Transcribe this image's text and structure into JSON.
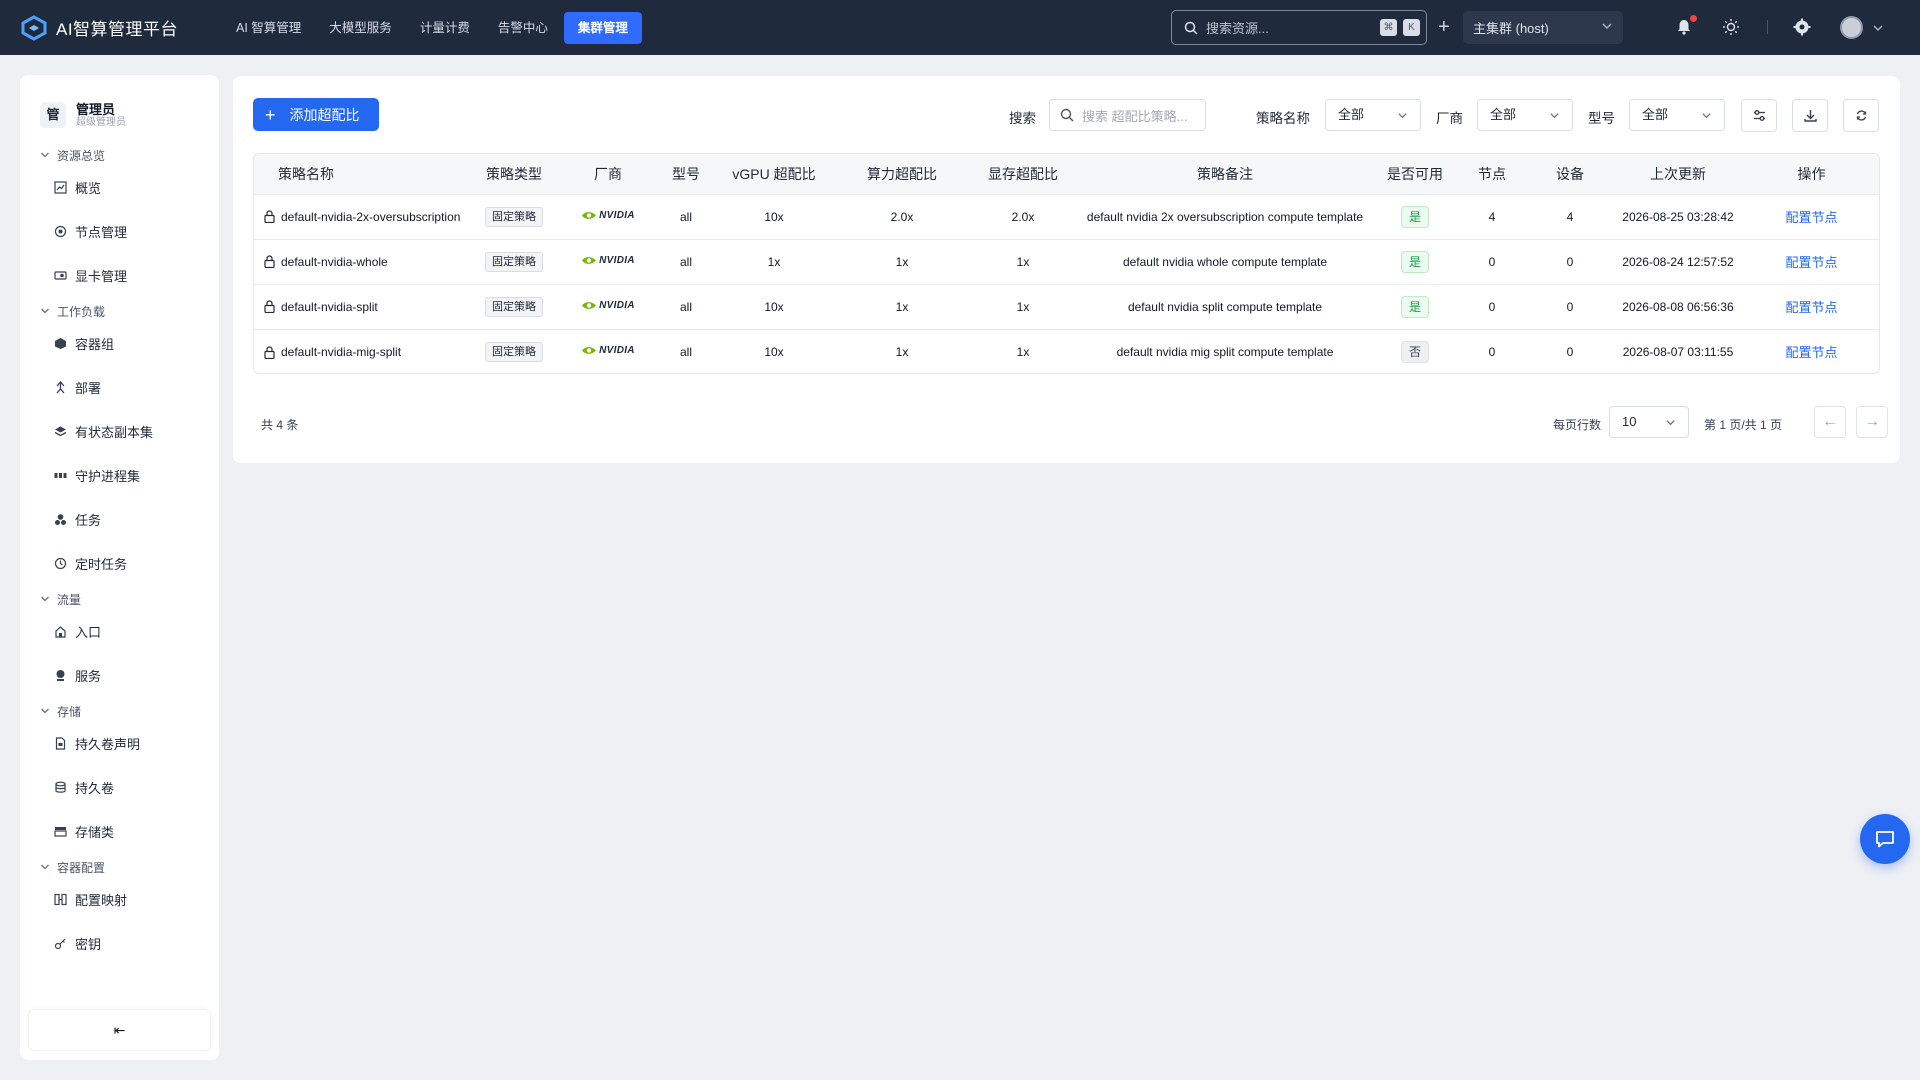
{
  "app": {
    "title": "AI智算管理平台"
  },
  "nav": [
    {
      "label": "AI 智算管理",
      "active": false
    },
    {
      "label": "大模型服务",
      "active": false
    },
    {
      "label": "计量计费",
      "active": false
    },
    {
      "label": "告警中心",
      "active": false
    },
    {
      "label": "集群管理",
      "active": true
    }
  ],
  "topbar": {
    "search_placeholder": "搜索资源...",
    "kbd": [
      "⌘",
      "K"
    ],
    "cluster": "主集群 (host)"
  },
  "sidebar": {
    "user": {
      "avatar_char": "管",
      "name": "管理员",
      "role": "超级管理员"
    },
    "groups": [
      {
        "label": "资源总览",
        "items": [
          {
            "label": "概览",
            "icon": "chart-icon"
          },
          {
            "label": "节点管理",
            "icon": "node-icon"
          },
          {
            "label": "显卡管理",
            "icon": "gpu-icon"
          }
        ]
      },
      {
        "label": "工作负载",
        "items": [
          {
            "label": "容器组",
            "icon": "cube-icon"
          },
          {
            "label": "部署",
            "icon": "deploy-icon"
          },
          {
            "label": "有状态副本集",
            "icon": "layers-icon"
          },
          {
            "label": "守护进程集",
            "icon": "daemon-icon"
          },
          {
            "label": "任务",
            "icon": "task-icon"
          },
          {
            "label": "定时任务",
            "icon": "clock-icon"
          }
        ]
      },
      {
        "label": "流量",
        "items": [
          {
            "label": "入口",
            "icon": "ingress-icon"
          },
          {
            "label": "服务",
            "icon": "service-icon"
          }
        ]
      },
      {
        "label": "存储",
        "items": [
          {
            "label": "持久卷声明",
            "icon": "pvc-icon"
          },
          {
            "label": "持久卷",
            "icon": "database-icon"
          },
          {
            "label": "存储类",
            "icon": "storage-class-icon"
          }
        ]
      },
      {
        "label": "容器配置",
        "items": [
          {
            "label": "配置映射",
            "icon": "configmap-icon"
          },
          {
            "label": "密钥",
            "icon": "key-icon"
          }
        ]
      }
    ],
    "collapse_glyph": "⇤"
  },
  "toolbar": {
    "add_label": "添加超配比",
    "search_label": "搜索",
    "search_placeholder": "搜索 超配比策略...",
    "filter_name_label": "策略名称",
    "filter_name_value": "全部",
    "filter_vendor_label": "厂商",
    "filter_vendor_value": "全部",
    "filter_model_label": "型号",
    "filter_model_value": "全部"
  },
  "table": {
    "headers": [
      "策略名称",
      "策略类型",
      "厂商",
      "型号",
      "vGPU 超配比",
      "算力超配比",
      "显存超配比",
      "策略备注",
      "是否可用",
      "节点",
      "设备",
      "上次更新",
      "操作"
    ],
    "rows": [
      {
        "name": "default-nvidia-2x-oversubscription",
        "type": "固定策略",
        "vendor": "NVIDIA",
        "model": "all",
        "vgpu": "10x",
        "compute": "2.0x",
        "memory": "2.0x",
        "note": "default nvidia 2x oversubscription compute template",
        "available": "是",
        "available_state": "yes",
        "nodes": "4",
        "devices": "4",
        "updated": "2026-08-25 03:28:42",
        "action": "配置节点"
      },
      {
        "name": "default-nvidia-whole",
        "type": "固定策略",
        "vendor": "NVIDIA",
        "model": "all",
        "vgpu": "1x",
        "compute": "1x",
        "memory": "1x",
        "note": "default nvidia whole compute template",
        "available": "是",
        "available_state": "yes",
        "nodes": "0",
        "devices": "0",
        "updated": "2026-08-24 12:57:52",
        "action": "配置节点"
      },
      {
        "name": "default-nvidia-split",
        "type": "固定策略",
        "vendor": "NVIDIA",
        "model": "all",
        "vgpu": "10x",
        "compute": "1x",
        "memory": "1x",
        "note": "default nvidia split compute template",
        "available": "是",
        "available_state": "yes",
        "nodes": "0",
        "devices": "0",
        "updated": "2026-08-08 06:56:36",
        "action": "配置节点"
      },
      {
        "name": "default-nvidia-mig-split",
        "type": "固定策略",
        "vendor": "NVIDIA",
        "model": "all",
        "vgpu": "10x",
        "compute": "1x",
        "memory": "1x",
        "note": "default nvidia mig split compute template",
        "available": "否",
        "available_state": "no",
        "nodes": "0",
        "devices": "0",
        "updated": "2026-08-07 03:11:55",
        "action": "配置节点"
      }
    ]
  },
  "pagination": {
    "total": "共 4 条",
    "page_size_label": "每页行数",
    "page_size": "10",
    "page_info": "第 1 页/共 1 页",
    "prev": "←",
    "next": "→"
  },
  "colors": {
    "primary": "#2468f2",
    "topbar": "#1f2a3d",
    "success": "#16a34a",
    "nvidia_green": "#76b900"
  }
}
